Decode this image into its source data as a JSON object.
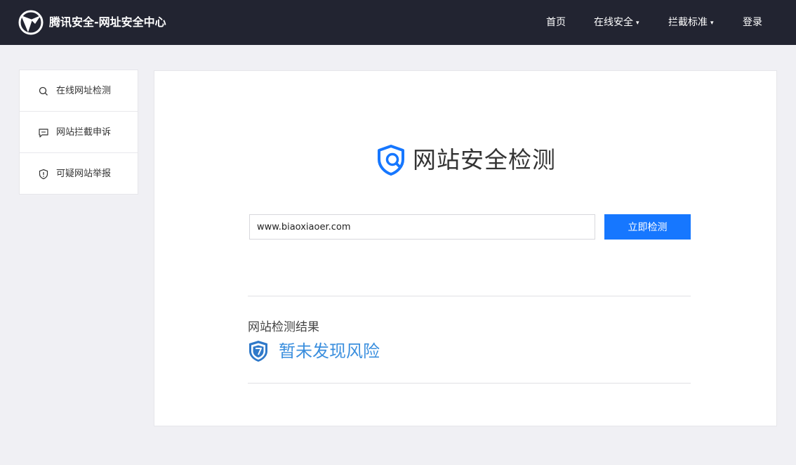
{
  "header": {
    "site_title": "腾讯安全-网址安全中心",
    "logo_icon": "tencent-security-logo",
    "nav": [
      {
        "label": "首页",
        "has_dropdown": false
      },
      {
        "label": "在线安全",
        "has_dropdown": true
      },
      {
        "label": "拦截标准",
        "has_dropdown": true
      },
      {
        "label": "登录",
        "has_dropdown": false
      }
    ],
    "caret": "▾"
  },
  "sidebar": {
    "items": [
      {
        "label": "在线网址检测",
        "icon": "search-icon"
      },
      {
        "label": "网站拦截申诉",
        "icon": "chat-icon"
      },
      {
        "label": "可疑网站举报",
        "icon": "shield-alert-icon"
      }
    ]
  },
  "main": {
    "brand_title": "网站安全检测",
    "brand_icon": "shield-search-icon",
    "url_input_value": "www.biaoxiaoer.com",
    "check_button_label": "立即检测",
    "result_heading": "网站检测结果",
    "result_text": "暂未发现风险",
    "result_icon": "shield-question-icon"
  },
  "colors": {
    "header_bg": "#222431",
    "page_bg": "#f0f0f4",
    "accent_blue": "#1677ff",
    "result_blue": "#3b8fde"
  }
}
